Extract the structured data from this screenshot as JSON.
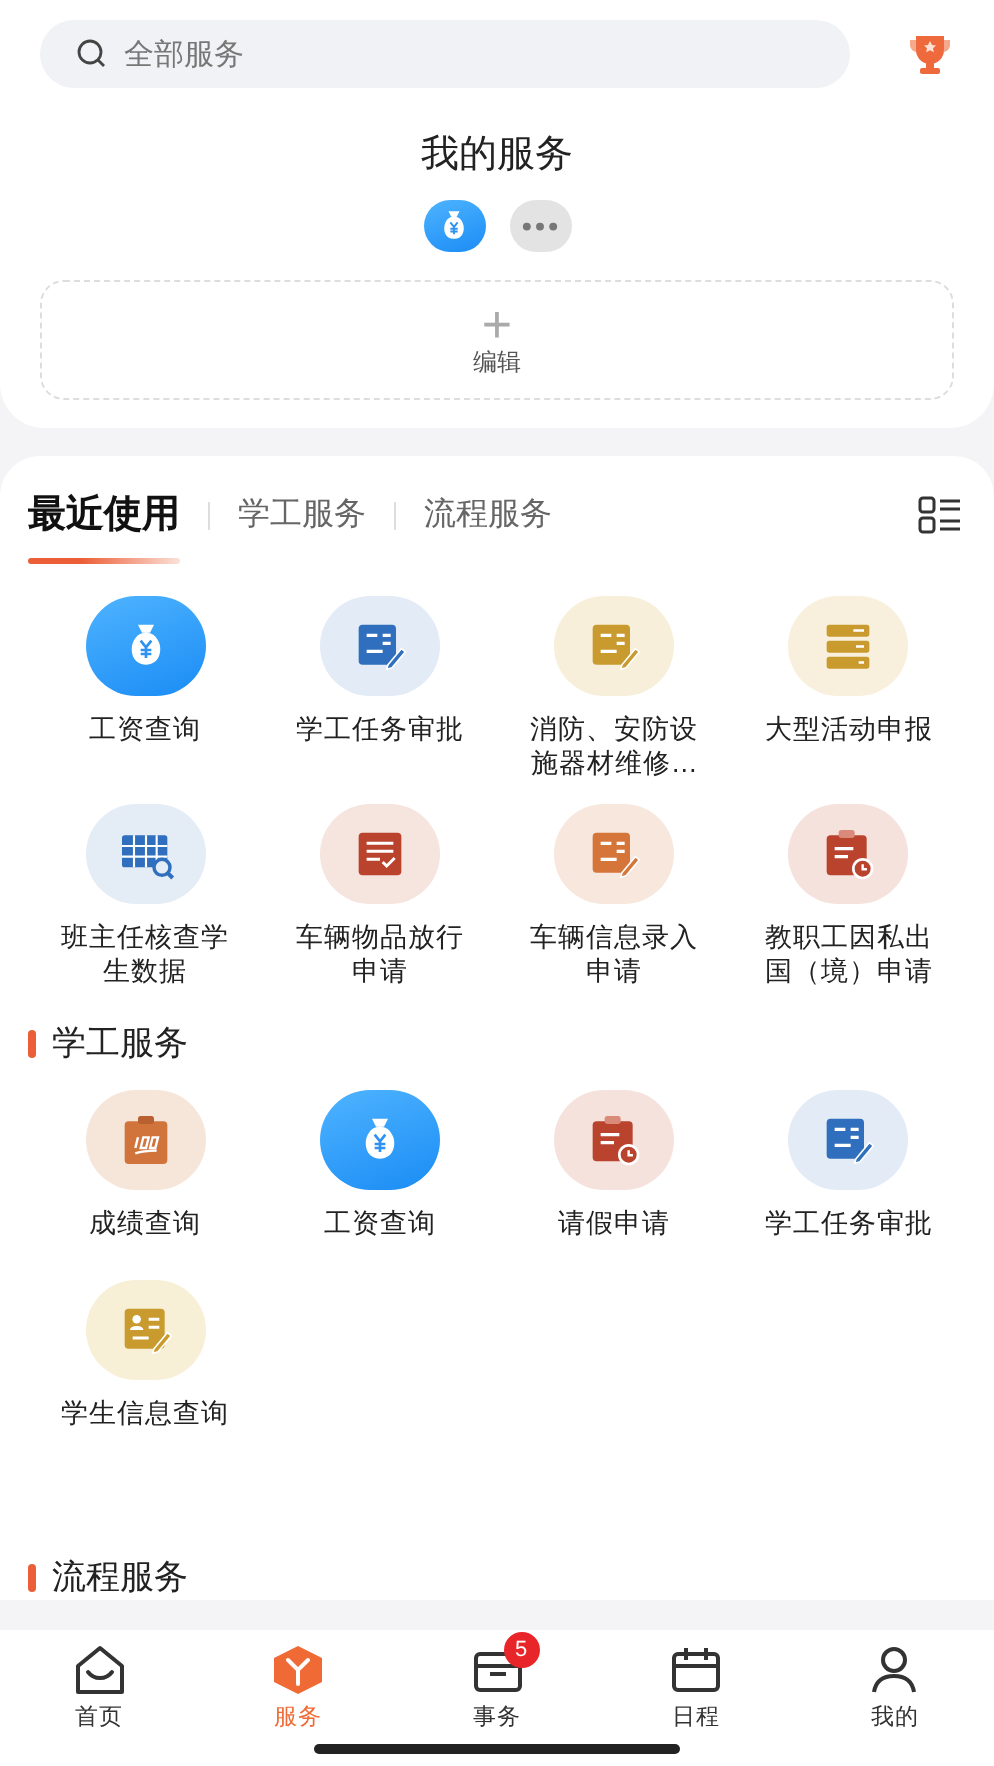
{
  "search": {
    "placeholder": "全部服务"
  },
  "my_services": {
    "title": "我的服务",
    "shortcuts": [
      {
        "kind": "moneybag"
      },
      {
        "kind": "more"
      }
    ],
    "edit": {
      "icon": "+",
      "label": "编辑"
    }
  },
  "tabs": [
    {
      "label": "最近使用",
      "selected": true
    },
    {
      "label": "学工服务",
      "selected": false
    },
    {
      "label": "流程服务",
      "selected": false
    }
  ],
  "recent": [
    {
      "kind": "moneybag",
      "label": "工资查询"
    },
    {
      "kind": "form-blue",
      "label": "学工任务审批"
    },
    {
      "kind": "form-gold",
      "label": "消防、安防设施器材维修…"
    },
    {
      "kind": "stack",
      "label": "大型活动申报"
    },
    {
      "kind": "table-search",
      "label": "班主任核查学生数据"
    },
    {
      "kind": "checklist",
      "label": "车辆物品放行申请"
    },
    {
      "kind": "form-orange",
      "label": "车辆信息录入申请"
    },
    {
      "kind": "clipboard-clock",
      "label": "教职工因私出国（境）申请"
    }
  ],
  "sections": [
    {
      "title": "学工服务",
      "items": [
        {
          "kind": "score",
          "label": "成绩查询"
        },
        {
          "kind": "moneybag",
          "label": "工资查询"
        },
        {
          "kind": "clipboard-clock",
          "label": "请假申请"
        },
        {
          "kind": "form-blue",
          "label": "学工任务审批"
        },
        {
          "kind": "person-form",
          "label": "学生信息查询"
        }
      ]
    },
    {
      "title": "流程服务"
    }
  ],
  "tab_bar": [
    {
      "kind": "home",
      "label": "首页",
      "selected": false
    },
    {
      "kind": "box",
      "label": "服务",
      "selected": true
    },
    {
      "kind": "tray",
      "label": "事务",
      "selected": false,
      "badge": "5"
    },
    {
      "kind": "calendar",
      "label": "日程",
      "selected": false
    },
    {
      "kind": "person",
      "label": "我的",
      "selected": false
    }
  ]
}
